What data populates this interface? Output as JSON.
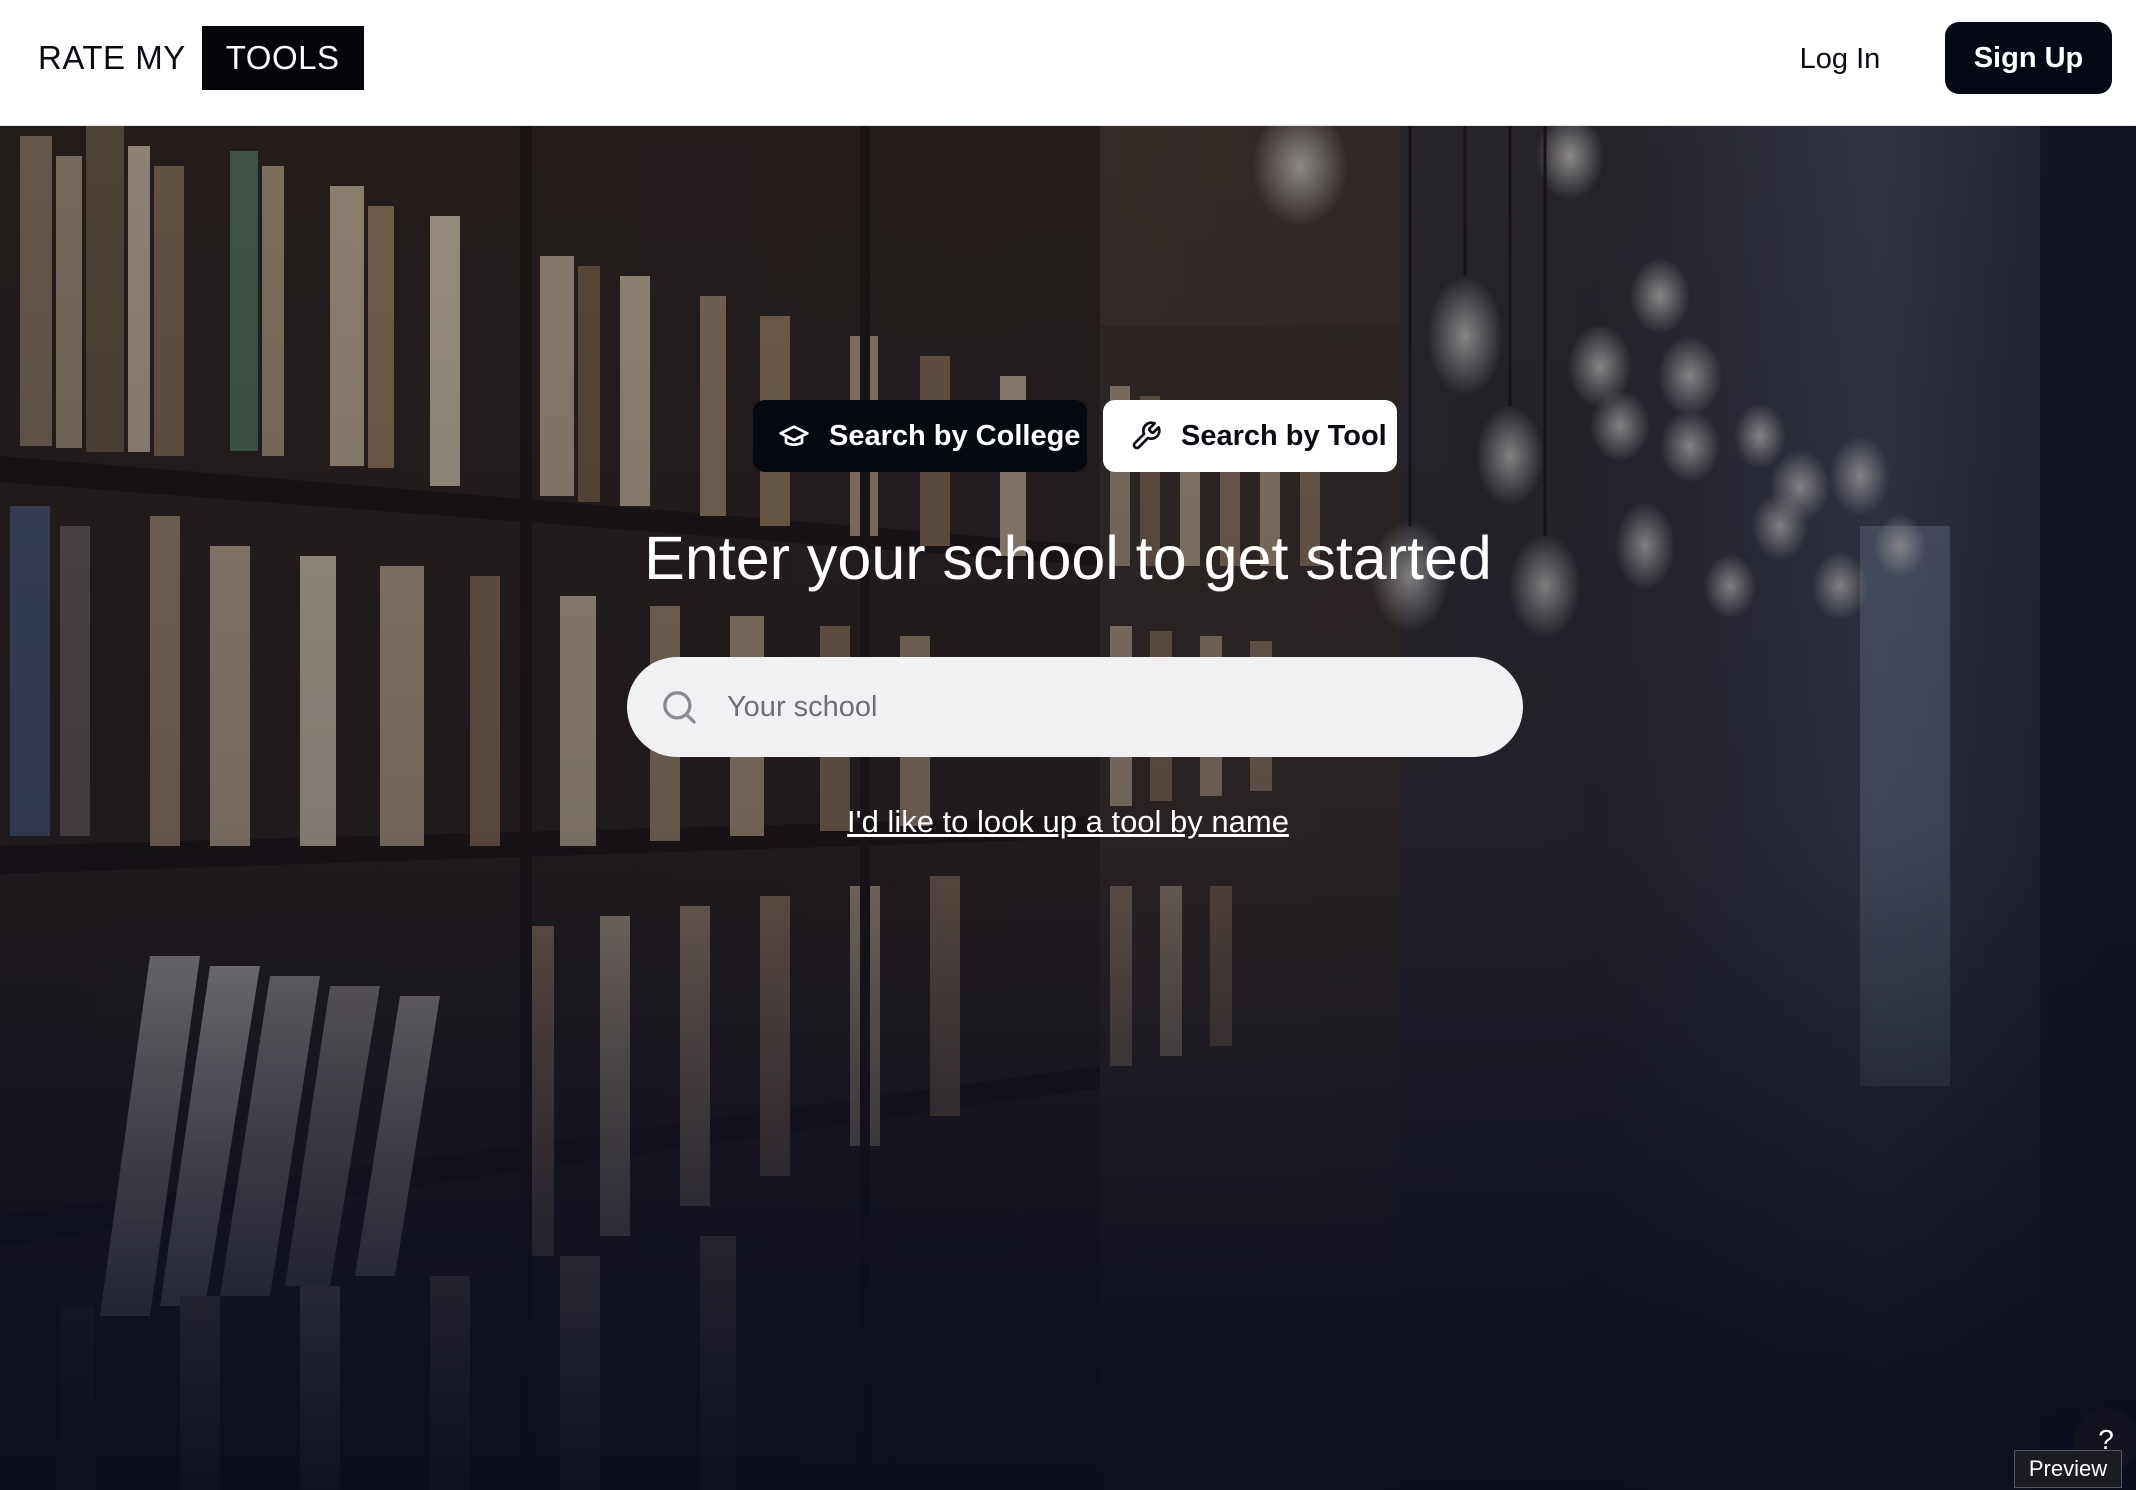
{
  "header": {
    "logo_part1": "RATE MY",
    "logo_part2": "TOOLS",
    "login_label": "Log In",
    "signup_label": "Sign Up"
  },
  "hero": {
    "search_mode_college": "Search by College",
    "search_mode_tool": "Search by Tool",
    "active_mode": "college",
    "headline": "Enter your school to get started",
    "search_placeholder": "Your school",
    "search_value": "",
    "lookup_link": "I'd like to look up a tool by name",
    "background": "library bookshelf photo with hanging light bulbs"
  },
  "help_label": "?",
  "preview_label": "Preview",
  "colors": {
    "primary_dark": "#050914",
    "header_bg": "#ffffff",
    "search_bg": "#f1f1f4",
    "text_light": "#ffffff"
  },
  "icons": {
    "college_mode": "graduation-cap-icon",
    "tool_mode": "wrench-icon",
    "search": "search-icon"
  }
}
